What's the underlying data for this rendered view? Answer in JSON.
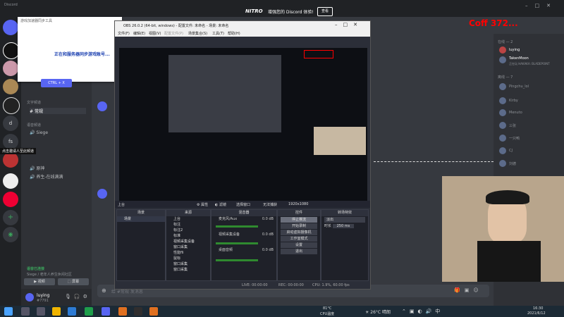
{
  "discord": {
    "app_title": "Discord",
    "nitro_logo": "NITRO",
    "nitro_banner_text": "增强您的 Discord 体验!",
    "nitro_button": "查看",
    "channels": {
      "text_category": "文字频道",
      "text_channel": "常规",
      "voice_category": "语音频道",
      "voice_channel_1": "Siege",
      "voice_channel_2": "原神",
      "voice_channel_3": "养生-在线满满",
      "invite_hint": "点击邀请人至此频道"
    },
    "voice_status": {
      "title": "语音已连接",
      "subtitle": "Siege / 老年人养生休闲社区"
    },
    "voice_buttons": {
      "video": "视频",
      "screen": "屏幕"
    },
    "user": {
      "name": "luying",
      "tag": "#7791"
    },
    "members": {
      "online_category": "在线 — 2",
      "online": [
        {
          "name": "luying"
        },
        {
          "name": "TakenMoon",
          "status": "正在玩 HAKAKA: BLADEPOINT"
        }
      ],
      "offline_category": "离线 — 7",
      "offline": [
        "Pingchu_lol",
        "Kirby",
        "Menuto",
        "三张",
        "一只鸭",
        "CJ",
        "刘德"
      ]
    },
    "message_placeholder": "给 #常规 发消息"
  },
  "popup": {
    "title": "游戏加速器同步工具",
    "message": "正在和服务器同步游戏账号...",
    "button": "CTRL + X"
  },
  "overlay_text": "Coff 372...",
  "obs": {
    "window_title": "OBS 26.0.2 (64-bit, windows) - 配置文件: 未命名 - 场景: 未命名",
    "menu": [
      "文件(F)",
      "编辑(E)",
      "视图(V)",
      "配置文件(P)",
      "场景集合(S)",
      "工具(T)",
      "帮助(H)"
    ],
    "scene_bar": {
      "scene_name": "上台",
      "properties": "属性",
      "filters": "滤镜",
      "source_select": "选择窗口",
      "capture_mode": "无法捕获",
      "resolution": "1920x1080"
    },
    "docks": {
      "scenes": {
        "title": "场景",
        "items": [
          "场景"
        ]
      },
      "sources": {
        "title": "来源",
        "items": [
          "上台",
          "标注",
          "标注2",
          "标准",
          "视频采集设备",
          "窗口采集",
          "性能fli",
          "鼠标",
          "窗口采集",
          "窗口采集"
        ]
      },
      "mixer": {
        "title": "混音器",
        "channels": [
          {
            "name": "麦克风/Aux",
            "db": "0.0 dB"
          },
          {
            "name": "视频采集设备",
            "db": "0.0 dB"
          },
          {
            "name": "桌面音频",
            "db": "0.0 dB"
          }
        ]
      },
      "controls": {
        "title": "控件",
        "buttons": [
          "停止推流",
          "开始录制",
          "启动虚拟摄像机",
          "工作室模式",
          "设置",
          "退出"
        ]
      },
      "transitions": {
        "title": "转场特效",
        "type": "淡出",
        "duration_label": "时长",
        "duration": "250 ms"
      }
    },
    "status": {
      "live": "LIVE: 00:00:00",
      "rec": "REC: 00:00:00",
      "cpu": "CPU: 1.9%, 60.00 fps"
    }
  },
  "taskbar": {
    "weather_temp": "26°C",
    "weather_desc": "晴朗",
    "cpu_temp": "81°C",
    "cpu_label": "CPU温度",
    "time": "16:30",
    "date": "2021/6/12"
  },
  "colors": {
    "discord_bg": "#36393f",
    "obs_bg": "#2b2e38",
    "accent_blue": "#5865f2",
    "online_green": "#3ba55c",
    "overlay_red": "#ff0000"
  }
}
